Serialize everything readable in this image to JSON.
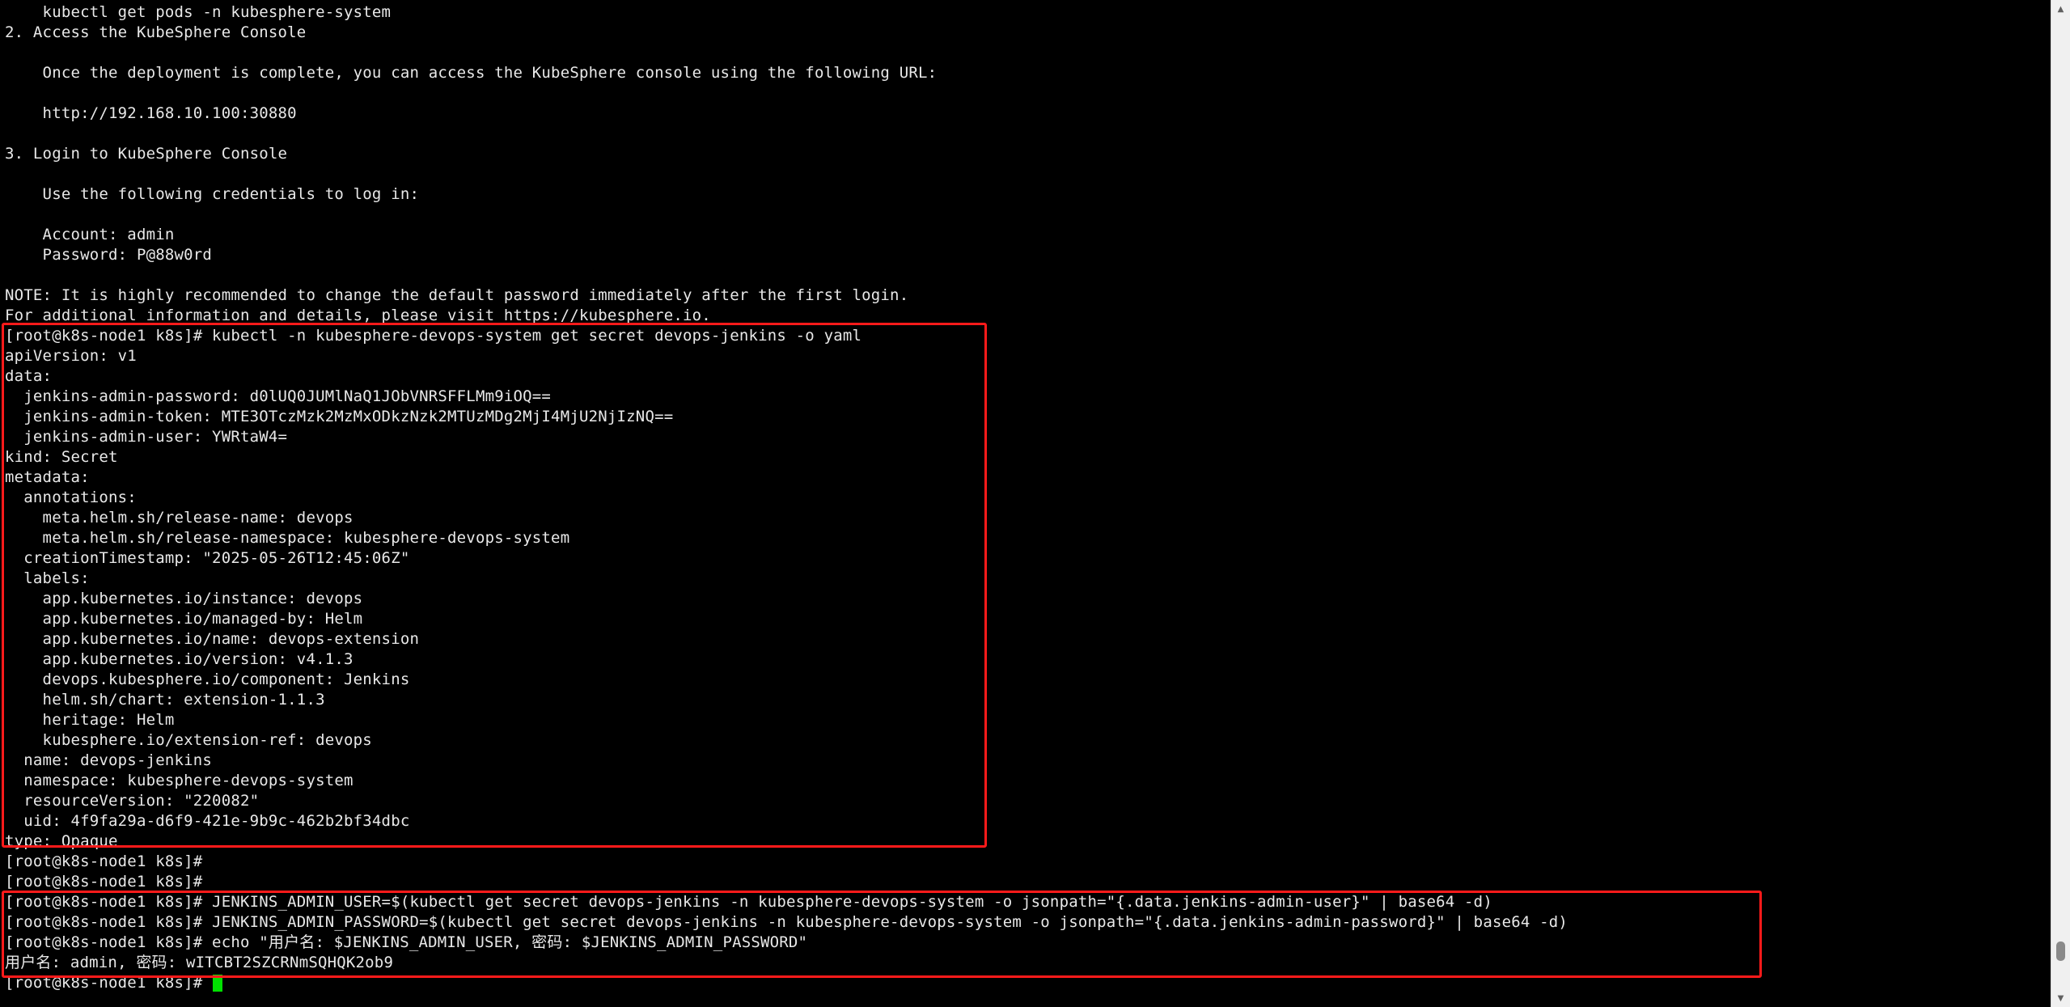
{
  "terminal": {
    "prompt": "[root@k8s-node1 k8s]#",
    "lines": [
      "    kubectl get pods -n kubesphere-system",
      "2. Access the KubeSphere Console",
      "",
      "    Once the deployment is complete, you can access the KubeSphere console using the following URL:",
      "",
      "    http://192.168.10.100:30880",
      "",
      "3. Login to KubeSphere Console",
      "",
      "    Use the following credentials to log in:",
      "",
      "    Account: admin",
      "    Password: P@88w0rd",
      "",
      "NOTE: It is highly recommended to change the default password immediately after the first login.",
      "For additional information and details, please visit https://kubesphere.io.",
      "[root@k8s-node1 k8s]# kubectl -n kubesphere-devops-system get secret devops-jenkins -o yaml",
      "apiVersion: v1",
      "data:",
      "  jenkins-admin-password: d0lUQ0JUMlNaQ1JObVNRSFFLMm9iOQ==",
      "  jenkins-admin-token: MTE3OTczMzk2MzMxODkzNzk2MTUzMDg2MjI4MjU2NjIzNQ==",
      "  jenkins-admin-user: YWRtaW4=",
      "kind: Secret",
      "metadata:",
      "  annotations:",
      "    meta.helm.sh/release-name: devops",
      "    meta.helm.sh/release-namespace: kubesphere-devops-system",
      "  creationTimestamp: \"2025-05-26T12:45:06Z\"",
      "  labels:",
      "    app.kubernetes.io/instance: devops",
      "    app.kubernetes.io/managed-by: Helm",
      "    app.kubernetes.io/name: devops-extension",
      "    app.kubernetes.io/version: v4.1.3",
      "    devops.kubesphere.io/component: Jenkins",
      "    helm.sh/chart: extension-1.1.3",
      "    heritage: Helm",
      "    kubesphere.io/extension-ref: devops",
      "  name: devops-jenkins",
      "  namespace: kubesphere-devops-system",
      "  resourceVersion: \"220082\"",
      "  uid: 4f9fa29a-d6f9-421e-9b9c-462b2bf34dbc",
      "type: Opaque",
      "[root@k8s-node1 k8s]#",
      "[root@k8s-node1 k8s]#",
      "[root@k8s-node1 k8s]# JENKINS_ADMIN_USER=$(kubectl get secret devops-jenkins -n kubesphere-devops-system -o jsonpath=\"{.data.jenkins-admin-user}\" | base64 -d)",
      "[root@k8s-node1 k8s]# JENKINS_ADMIN_PASSWORD=$(kubectl get secret devops-jenkins -n kubesphere-devops-system -o jsonpath=\"{.data.jenkins-admin-password}\" | base64 -d)",
      "[root@k8s-node1 k8s]# echo \"用户名: $JENKINS_ADMIN_USER, 密码: $JENKINS_ADMIN_PASSWORD\"",
      "用户名: admin, 密码: wITCBT2SZCRNmSQHQK2ob9",
      "[root@k8s-node1 k8s]# "
    ]
  },
  "scrollbar": {
    "position_fraction": 0.97,
    "visible_fraction": 0.02,
    "up_icon": "▲",
    "down_icon": "▼"
  },
  "colors": {
    "background": "#000000",
    "text": "#e8e8e8",
    "cursor": "#00e000",
    "highlight": "#ff1a1a"
  }
}
